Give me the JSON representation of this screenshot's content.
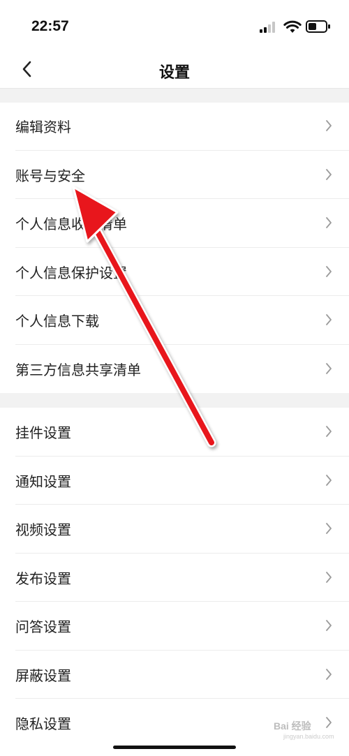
{
  "status_bar": {
    "time": "22:57",
    "icons": [
      "cellular-signal-icon",
      "wifi-icon",
      "battery-icon"
    ]
  },
  "nav": {
    "back_icon": "chevron-left-icon",
    "title": "设置"
  },
  "sections": [
    {
      "items": [
        {
          "label": "编辑资料"
        },
        {
          "label": "账号与安全"
        },
        {
          "label": "个人信息收集清单"
        },
        {
          "label": "个人信息保护设置"
        },
        {
          "label": "个人信息下载"
        },
        {
          "label": "第三方信息共享清单"
        }
      ]
    },
    {
      "items": [
        {
          "label": "挂件设置"
        },
        {
          "label": "通知设置"
        },
        {
          "label": "视频设置"
        },
        {
          "label": "发布设置"
        },
        {
          "label": "问答设置"
        },
        {
          "label": "屏蔽设置"
        },
        {
          "label": "隐私设置"
        }
      ]
    }
  ],
  "annotation": {
    "type": "red-arrow",
    "points_to": "账号与安全",
    "color": "#e8141b"
  },
  "watermark": {
    "text": "Bai 经验",
    "subtext": "jingyan.baidu.com"
  },
  "colors": {
    "background": "#ffffff",
    "section_gap": "#f2f2f2",
    "chevron": "#9b9b9b",
    "text": "#222222"
  }
}
